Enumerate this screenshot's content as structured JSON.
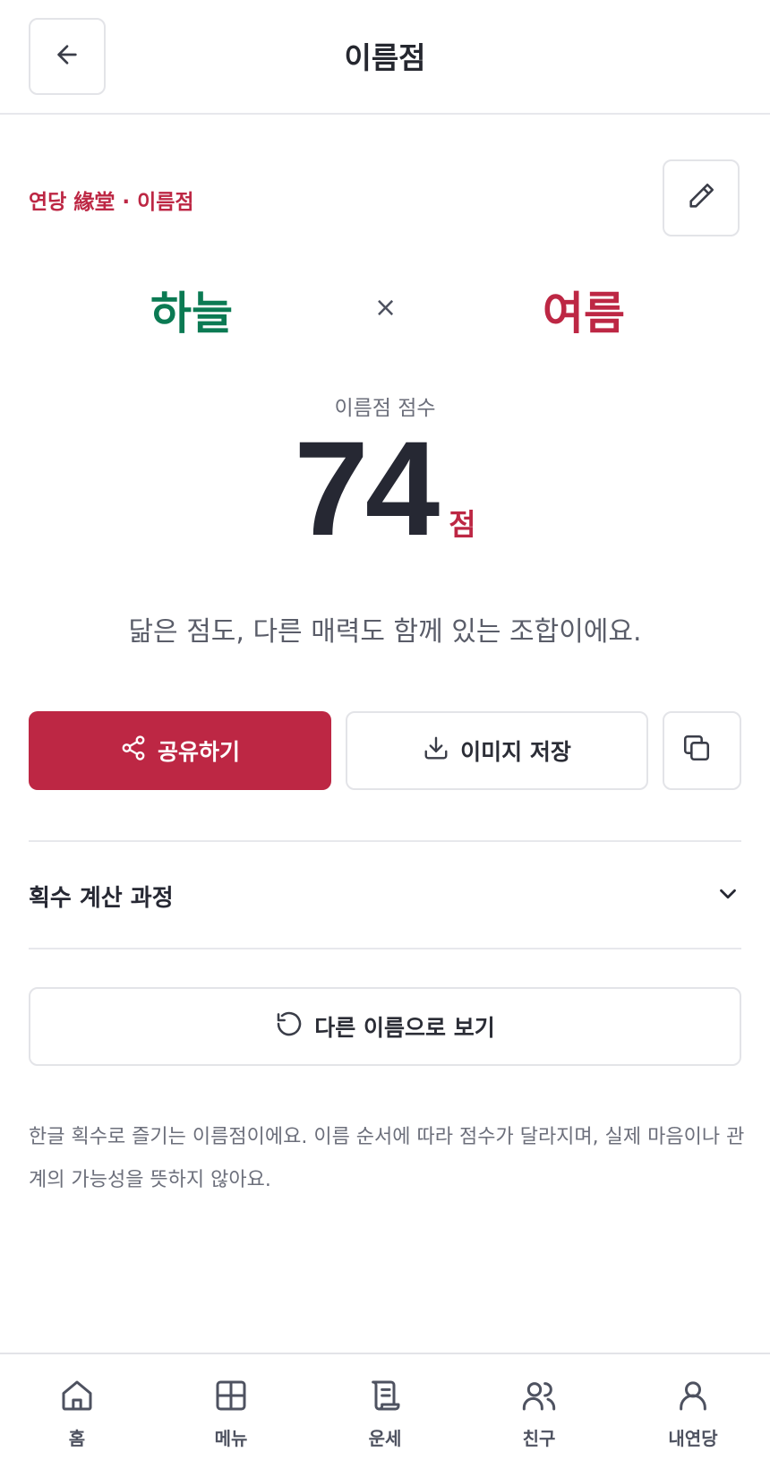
{
  "header": {
    "title": "이름점"
  },
  "brand": {
    "label": "연당 緣堂 · 이름점"
  },
  "names": {
    "first": "하늘",
    "separator": "×",
    "second": "여름"
  },
  "score": {
    "label": "이름점 점수",
    "value": "74",
    "unit": "점"
  },
  "description": "닮은 점도, 다른 매력도 함께 있는 조합이에요.",
  "actions": {
    "share_label": "공유하기",
    "save_label": "이미지 저장"
  },
  "accordion": {
    "title": "획수 계산 과정"
  },
  "retry": {
    "label": "다른 이름으로 보기"
  },
  "notice": "한글 획수로 즐기는 이름점이에요. 이름 순서에 따라 점수가 달라지며, 실제 마음이나 관계의 가능성을 뜻하지 않아요.",
  "tabbar": {
    "items": [
      {
        "label": "홈",
        "icon": "home-icon"
      },
      {
        "label": "메뉴",
        "icon": "grid-icon"
      },
      {
        "label": "운세",
        "icon": "scroll-icon"
      },
      {
        "label": "친구",
        "icon": "friends-icon"
      },
      {
        "label": "내연당",
        "icon": "user-icon"
      }
    ]
  },
  "colors": {
    "accent": "#bd2744",
    "name_first": "#0b7a53",
    "name_second": "#bd2744"
  }
}
